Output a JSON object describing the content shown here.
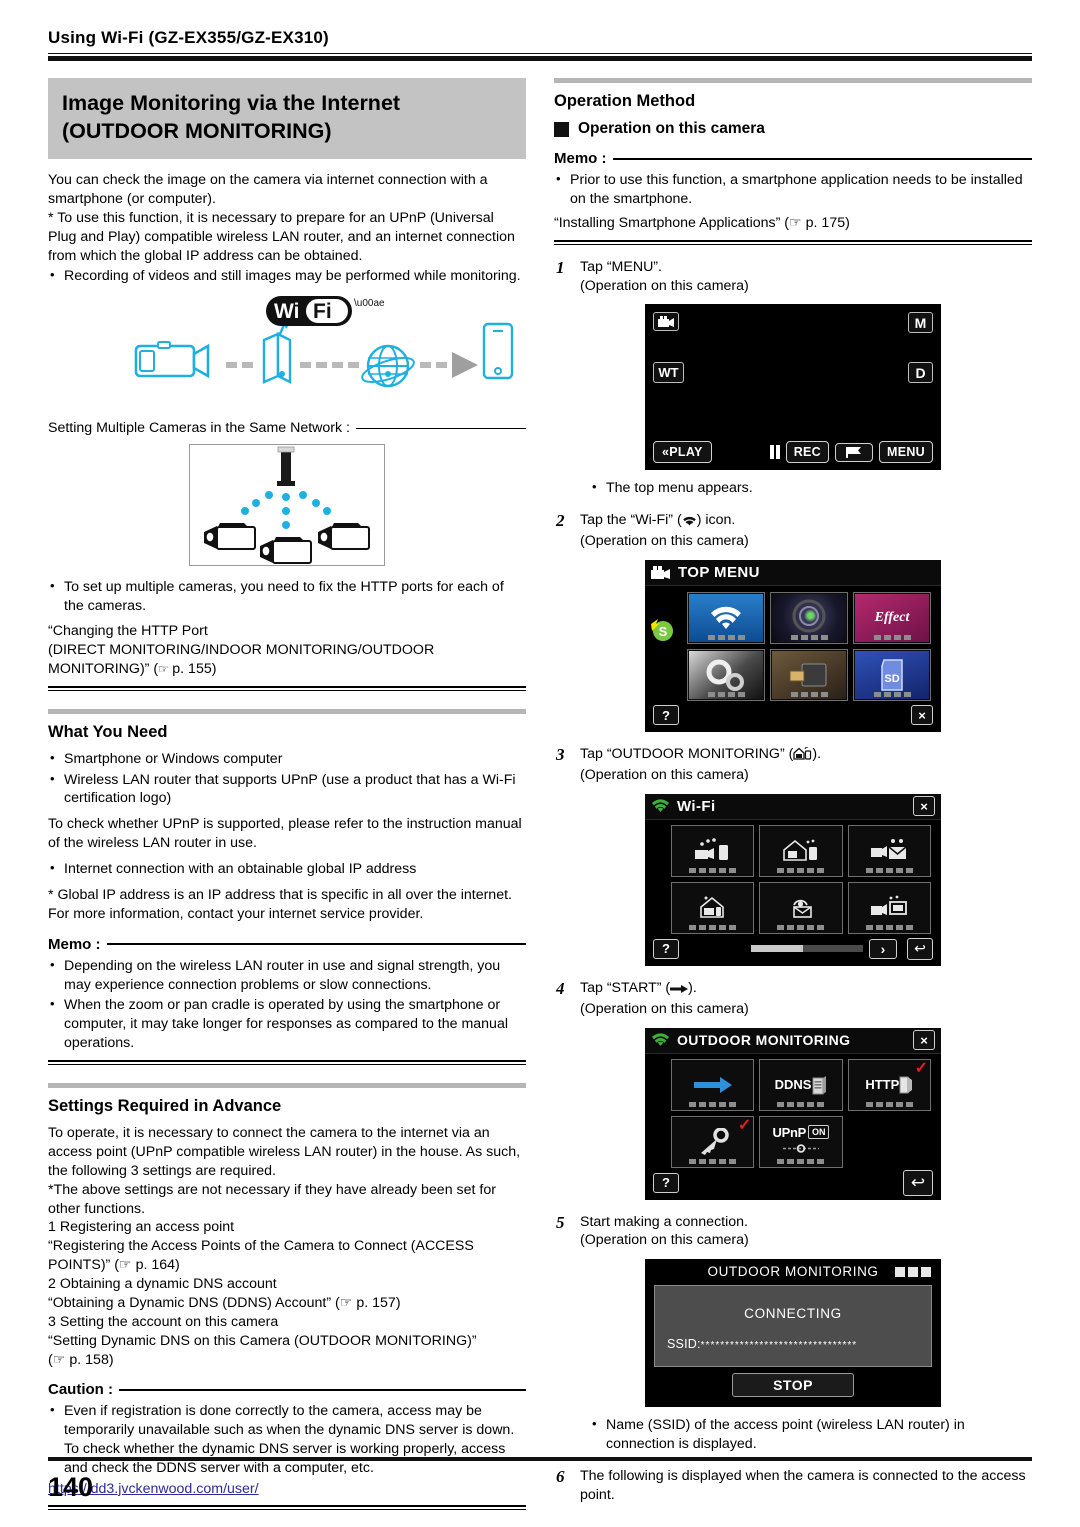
{
  "running_head": "Using Wi-Fi (GZ-EX355/GZ-EX310)",
  "page_number": "140",
  "left": {
    "title_line1": "Image Monitoring via the Internet",
    "title_line2": "(OUTDOOR MONITORING)",
    "intro_1": "You can check the image on the camera via internet connection with a smartphone (or computer).",
    "intro_2": "* To use this function, it is necessary to prepare for an UPnP (Universal Plug and Play) compatible wireless LAN router, and an internet connection from which the global IP address can be obtained.",
    "intro_bullet": "Recording of videos and still images may be performed while monitoring.",
    "figure_flow": {
      "wifi_logo": "WiFi",
      "items": [
        "camcorder",
        "wireless-router",
        "globe",
        "arrow",
        "smartphone"
      ]
    },
    "multi_label": "Setting Multiple Cameras in the Same Network :",
    "multi_bullet": "To set up multiple cameras, you need to fix the HTTP ports for each of the cameras.",
    "http_ref_l1": "“Changing the HTTP Port",
    "http_ref_l2": "(DIRECT MONITORING/INDOOR MONITORING/OUTDOOR",
    "http_ref_l3": "MONITORING)” (",
    "http_ref_page": " p. 155)",
    "what_you_need": {
      "heading": "What You Need",
      "bullets": [
        "Smartphone or Windows computer",
        "Wireless LAN router that supports UPnP (use a product that has a Wi-Fi certification logo)"
      ],
      "note1": "To check whether UPnP is supported, please refer to the instruction manual of the wireless LAN router in use.",
      "bullet2": "Internet connection with an obtainable global IP address",
      "note2": "* Global IP address is an IP address that is specific in all over the internet. For more information, contact your internet service provider."
    },
    "memo": {
      "label": "Memo :",
      "bullets": [
        "Depending on the wireless LAN router in use and signal strength, you may experience connection problems or slow connections.",
        "When the zoom or pan cradle is operated by using the smartphone or computer, it may take longer for responses as compared to the manual operations."
      ]
    },
    "settings": {
      "heading": "Settings Required in Advance",
      "para1": "To operate, it is necessary to connect the camera to the internet via an access point (UPnP compatible wireless LAN router) in the house. As such, the following 3 settings are required.",
      "para2": "*The above settings are not necessary if they have already been set for other functions.",
      "items": [
        "1 Registering an access point",
        "“Registering the Access Points of the Camera to Connect (ACCESS POINTS)” (☞ p. 164)",
        "2 Obtaining a dynamic DNS account",
        "“Obtaining a Dynamic DNS (DDNS) Account” (☞ p. 157)",
        "3 Setting the account on this camera",
        "“Setting Dynamic DNS on this Camera (OUTDOOR MONITORING)”",
        "(☞ p. 158)"
      ]
    },
    "caution": {
      "label": "Caution :",
      "bullet": "Even if registration is done correctly to the camera, access may be temporarily unavailable such as when the dynamic DNS server is down. To check whether the dynamic DNS server is working properly, access and check the DDNS server with a computer, etc.",
      "url": "https://dd3.jvckenwood.com/user/"
    }
  },
  "right": {
    "heading": "Operation Method",
    "subheading": "Operation on this camera",
    "memo": {
      "label": "Memo :",
      "bullet": "Prior to use this function, a smartphone application needs to be installed on the smartphone.",
      "ref": "“Installing Smartphone Applications” (☞ p. 175)"
    },
    "steps": [
      {
        "num": "1",
        "line1": "Tap “MENU”.",
        "line2": "(Operation on this camera)"
      },
      {
        "num": "2",
        "line1": "Tap the “Wi-Fi” (●) icon.",
        "line2": "(Operation on this camera)"
      },
      {
        "num": "3",
        "line1": "Tap “OUTDOOR MONITORING” (⌂).",
        "line2": "(Operation on this camera)"
      },
      {
        "num": "4",
        "line1": "Tap “START” (➡).",
        "line2": "(Operation on this camera)"
      },
      {
        "num": "5",
        "line1": "Start making a connection.",
        "line2": "(Operation on this camera)"
      },
      {
        "num": "6",
        "line1": "The following is displayed when the camera is connected to the access point.",
        "line2": ""
      }
    ],
    "after_step1_bullet": "The top menu appears.",
    "after_step5_bullet": "Name (SSID) of the access point (wireless LAN router) in connection is displayed.",
    "screens": {
      "rec": {
        "name": "recording-screen",
        "icons": {
          "mode": "camcorder-icon",
          "m": "M",
          "wt": "WT",
          "d": "D"
        },
        "buttons": [
          "PLAY",
          "pause",
          "REC",
          "flag",
          "MENU"
        ]
      },
      "top_menu": {
        "title": "TOP MENU",
        "tiles": [
          "wifi",
          "recording-settings",
          "special-recording",
          "basic-settings",
          "connection-settings",
          "media-settings"
        ],
        "help": "?",
        "close": "×"
      },
      "wifi_menu": {
        "title": "Wi-Fi",
        "tiles": [
          "direct-monitoring",
          "indoor-monitoring",
          "video-mail",
          "outdoor-monitoring",
          "detect-mail",
          "tv-monitoring"
        ],
        "help": "?",
        "close": "×",
        "next": "›",
        "back": "↩"
      },
      "outdoor_menu": {
        "title": "OUTDOOR MONITORING",
        "tiles": [
          {
            "label": "START",
            "checked": false
          },
          {
            "label": "DDNS",
            "checked": false
          },
          {
            "label": "HTTP",
            "checked": true
          },
          {
            "label": "PASSWORD",
            "checked": true
          },
          {
            "label": "UPnP",
            "state": "ON",
            "checked": false
          }
        ],
        "help": "?",
        "close": "×",
        "back": "↩"
      },
      "connecting": {
        "title": "OUTDOOR MONITORING",
        "status": "CONNECTING",
        "ssid_label": "SSID:",
        "ssid_value": "********************************",
        "stop": "STOP"
      }
    }
  },
  "colors": {
    "accent_cyan": "#1fb0e0",
    "title_band": "#c3c3c3",
    "link": "#2b2b9b",
    "check_red": "#e02020"
  }
}
